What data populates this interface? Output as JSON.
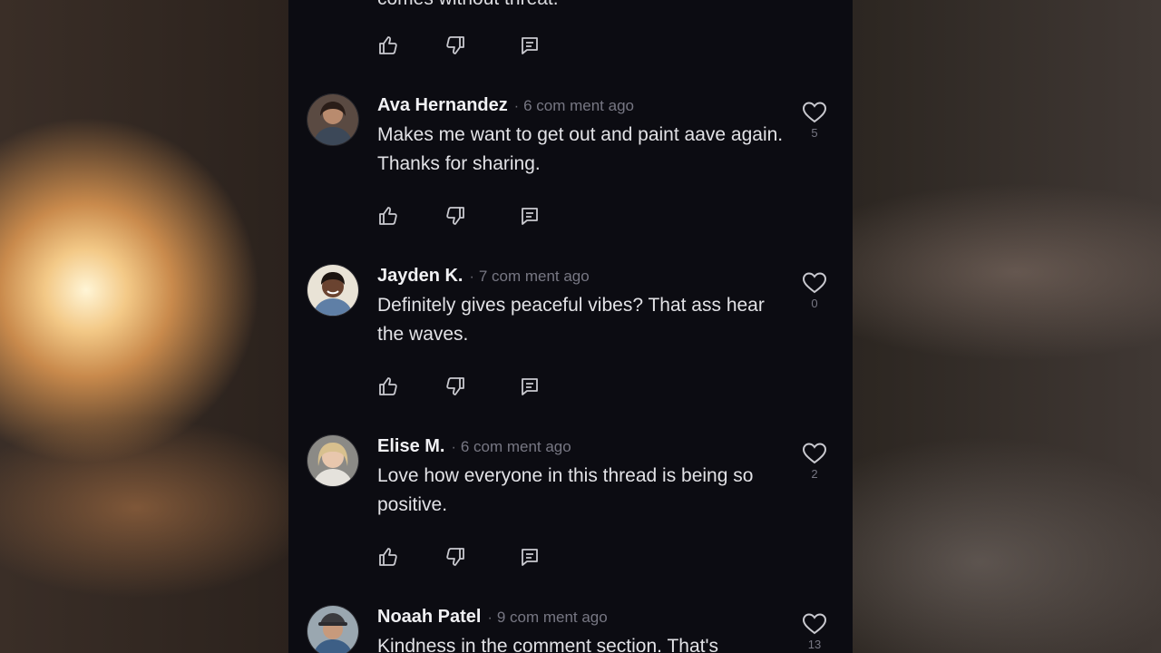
{
  "background": {
    "panel_color": "#0c0c12",
    "text_color": "#e2e2e6",
    "muted_color": "#777783"
  },
  "top_partial": {
    "text": "comes without threat."
  },
  "comments": [
    {
      "author": "Ava Hernandez",
      "time": "6 com ment ago",
      "text": "Makes me want to get out and paint aave again. Thanks for sharing.",
      "likes": "5",
      "avatar_icon": "avatar-woman-dark-hair"
    },
    {
      "author": "Jayden K.",
      "time": "7 com ment ago",
      "text": "Definitely gives peaceful vibes? That ass hear the waves.",
      "likes": "0",
      "avatar_icon": "avatar-man-smiling"
    },
    {
      "author": "Elise M.",
      "time": "6 com ment ago",
      "text": "Love how everyone in this thread is being so positive.",
      "likes": "2",
      "avatar_icon": "avatar-woman-blonde"
    },
    {
      "author": "Noaah Patel",
      "time": "9 com ment ago",
      "text": "Kindness in the comment section. That's",
      "likes": "13",
      "avatar_icon": "avatar-man-hat"
    }
  ],
  "icons": {
    "like": "thumbs-up-icon",
    "dislike": "thumbs-down-icon",
    "reply": "reply-icon",
    "heart": "heart-icon"
  }
}
